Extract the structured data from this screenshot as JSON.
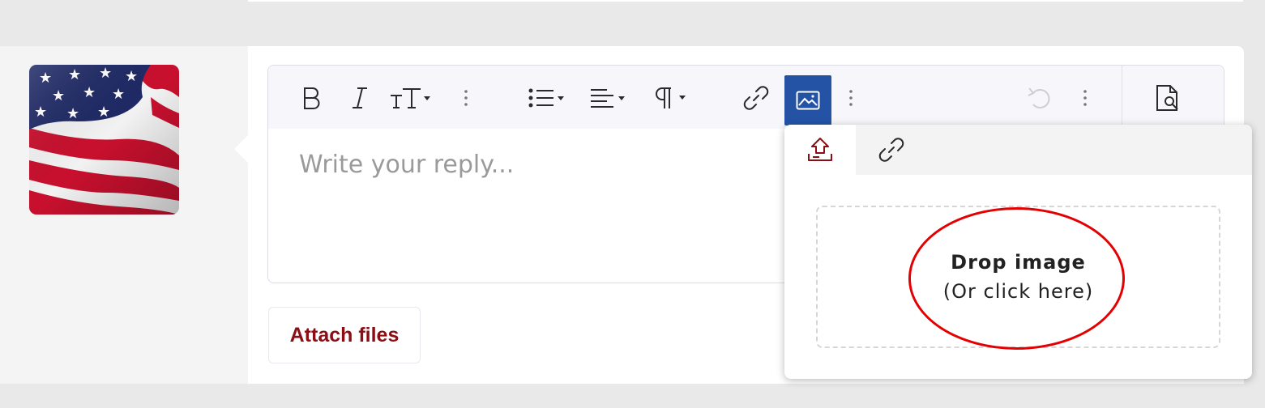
{
  "editor": {
    "placeholder": "Write your reply...",
    "toolbar": [
      {
        "name": "bold-button",
        "icon": "bold-icon"
      },
      {
        "name": "italic-button",
        "icon": "italic-icon"
      },
      {
        "name": "font-size-button",
        "icon": "text-size-icon"
      },
      {
        "name": "more-text-button",
        "icon": "more-vertical-icon"
      },
      {
        "name": "list-button",
        "icon": "list-icon"
      },
      {
        "name": "align-button",
        "icon": "align-icon"
      },
      {
        "name": "paragraph-button",
        "icon": "paragraph-icon"
      },
      {
        "name": "insert-link-button",
        "icon": "link-icon"
      },
      {
        "name": "insert-image-button",
        "icon": "image-icon",
        "active": true
      },
      {
        "name": "more-insert-button",
        "icon": "more-vertical-icon"
      },
      {
        "name": "undo-button",
        "icon": "undo-icon"
      },
      {
        "name": "more-options-button",
        "icon": "more-vertical-icon"
      },
      {
        "name": "preview-button",
        "icon": "preview-icon"
      }
    ],
    "active_color": "#2453a6"
  },
  "attach": {
    "label": "Attach files",
    "color": "#8b0e15"
  },
  "image_popup": {
    "tabs": [
      {
        "name": "upload",
        "icon": "upload-icon",
        "active": true
      },
      {
        "name": "by-url",
        "icon": "link-icon"
      }
    ],
    "drop_title": "Drop image",
    "drop_subtitle": "(Or click here)"
  },
  "avatar": {
    "icon": "us-flag-image"
  },
  "annotation": {
    "color": "#e40000"
  }
}
